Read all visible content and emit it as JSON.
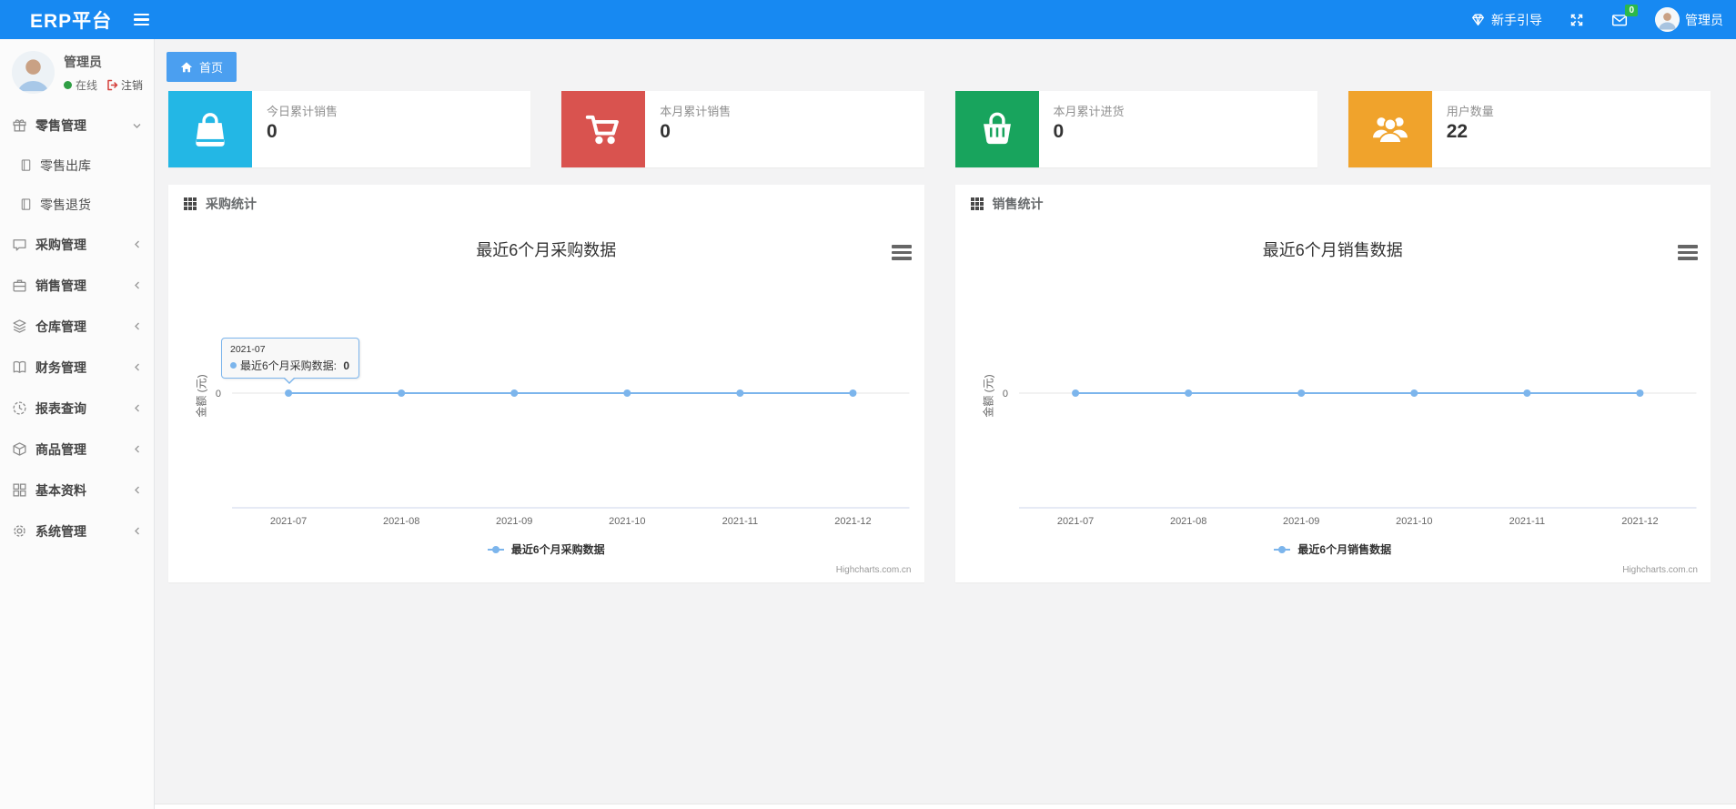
{
  "navbar": {
    "brand": "ERP平台",
    "guide_label": "新手引导",
    "message_badge": "0",
    "user_name": "管理员"
  },
  "sidebar": {
    "user": {
      "name": "管理员",
      "status": "在线",
      "logout_label": "注销"
    },
    "items": [
      {
        "key": "retail",
        "label": "零售管理",
        "icon": "gift",
        "expanded": true,
        "children": [
          {
            "key": "retail-out",
            "label": "零售出库",
            "icon": "file"
          },
          {
            "key": "retail-return",
            "label": "零售退货",
            "icon": "file"
          }
        ]
      },
      {
        "key": "purchase",
        "label": "采购管理",
        "icon": "comment",
        "expanded": false
      },
      {
        "key": "sales",
        "label": "销售管理",
        "icon": "briefcase",
        "expanded": false
      },
      {
        "key": "warehouse",
        "label": "仓库管理",
        "icon": "layers",
        "expanded": false
      },
      {
        "key": "finance",
        "label": "财务管理",
        "icon": "book",
        "expanded": false
      },
      {
        "key": "report",
        "label": "报表查询",
        "icon": "clock",
        "expanded": false
      },
      {
        "key": "goods",
        "label": "商品管理",
        "icon": "cube",
        "expanded": false
      },
      {
        "key": "basic",
        "label": "基本资料",
        "icon": "grid",
        "expanded": false
      },
      {
        "key": "system",
        "label": "系统管理",
        "icon": "gear",
        "expanded": false
      }
    ]
  },
  "tabs": [
    {
      "label": "首页",
      "icon": "home",
      "active": true
    }
  ],
  "stat_cards": [
    {
      "label": "今日累计销售",
      "value": "0",
      "icon": "shopping-bag",
      "color": "#23b7e5"
    },
    {
      "label": "本月累计销售",
      "value": "0",
      "icon": "shopping-cart",
      "color": "#d9534f"
    },
    {
      "label": "本月累计进货",
      "value": "0",
      "icon": "basket",
      "color": "#18a45d"
    },
    {
      "label": "用户数量",
      "value": "22",
      "icon": "users",
      "color": "#f0a32c"
    }
  ],
  "chart_data": [
    {
      "type": "line",
      "panel_title": "采购统计",
      "title": "最近6个月采购数据",
      "categories": [
        "2021-07",
        "2021-08",
        "2021-09",
        "2021-10",
        "2021-11",
        "2021-12"
      ],
      "series": [
        {
          "name": "最近6个月采购数据",
          "values": [
            0,
            0,
            0,
            0,
            0,
            0
          ],
          "color": "#7cb5ec"
        }
      ],
      "xlabel": "",
      "ylabel": "金额 (元)",
      "yticks": [
        "0"
      ],
      "ylim": [
        0,
        1
      ],
      "grid": false,
      "legend_position": "bottom",
      "credits": "Highcharts.com.cn",
      "tooltip": {
        "header": "2021-07",
        "series": "最近6个月采购数据",
        "value": "0",
        "point_index": 0
      }
    },
    {
      "type": "line",
      "panel_title": "销售统计",
      "title": "最近6个月销售数据",
      "categories": [
        "2021-07",
        "2021-08",
        "2021-09",
        "2021-10",
        "2021-11",
        "2021-12"
      ],
      "series": [
        {
          "name": "最近6个月销售数据",
          "values": [
            0,
            0,
            0,
            0,
            0,
            0
          ],
          "color": "#7cb5ec"
        }
      ],
      "xlabel": "",
      "ylabel": "金额 (元)",
      "yticks": [
        "0"
      ],
      "ylim": [
        0,
        1
      ],
      "grid": false,
      "legend_position": "bottom",
      "credits": "Highcharts.com.cn",
      "tooltip": null
    }
  ]
}
